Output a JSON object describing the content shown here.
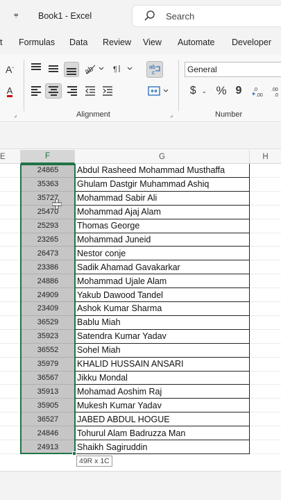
{
  "titlebar": {
    "menu_glyph": "⩦",
    "doc_title": "Book1 - Excel",
    "search_placeholder": "Search"
  },
  "tabs": [
    {
      "label": "t"
    },
    {
      "label": "Formulas"
    },
    {
      "label": "Data"
    },
    {
      "label": "Review"
    },
    {
      "label": "View"
    },
    {
      "label": "Automate"
    },
    {
      "label": "Developer"
    }
  ],
  "ribbon": {
    "font_size_glyph": "A",
    "font_color_glyph": "A",
    "alignment_label": "Alignment",
    "number_label": "Number",
    "number_format": "General",
    "currency_glyph": "$",
    "percent_glyph": "%",
    "comma_glyph": "9"
  },
  "columns": {
    "e": "E",
    "f": "F",
    "g": "G",
    "h": "H"
  },
  "rows": [
    {
      "f": "24865",
      "g": "Abdul Rasheed Mohammad Musthaffa"
    },
    {
      "f": "35363",
      "g": "Ghulam Dastgir Muhammad Ashiq"
    },
    {
      "f": "35727",
      "g": "Mohammad Sabir Ali"
    },
    {
      "f": "25470",
      "g": "Mohammad Ajaj Alam"
    },
    {
      "f": "25293",
      "g": "Thomas George"
    },
    {
      "f": "23265",
      "g": "Mohammad Juneid"
    },
    {
      "f": "26473",
      "g": "Nestor conje"
    },
    {
      "f": "23386",
      "g": "Sadik Ahamad Gavakarkar"
    },
    {
      "f": "24886",
      "g": "Mohammad Ujale Alam"
    },
    {
      "f": "24909",
      "g": "Yakub Dawood Tandel"
    },
    {
      "f": "23409",
      "g": "Ashok Kumar Sharma"
    },
    {
      "f": "36529",
      "g": "Bablu Miah"
    },
    {
      "f": "35923",
      "g": "Satendra Kumar Yadav"
    },
    {
      "f": "36552",
      "g": "Sohel Miah"
    },
    {
      "f": "35979",
      "g": "KHALID HUSSAIN ANSARI"
    },
    {
      "f": "36567",
      "g": "Jikku Mondal"
    },
    {
      "f": "35913",
      "g": "Mohamad Aoshim Raj"
    },
    {
      "f": "35905",
      "g": "Mukesh Kumar Yadav"
    },
    {
      "f": "36527",
      "g": "JABED ABDUL HOGUE"
    },
    {
      "f": "24846",
      "g": "Tohurul Alam Badruzza Man"
    },
    {
      "f": "24913",
      "g": "Shaikh Sagiruddin"
    }
  ],
  "selection_tooltip": "49R x 1C",
  "colors": {
    "accent": "#217346",
    "selection_fill": "#c6c6c6"
  }
}
